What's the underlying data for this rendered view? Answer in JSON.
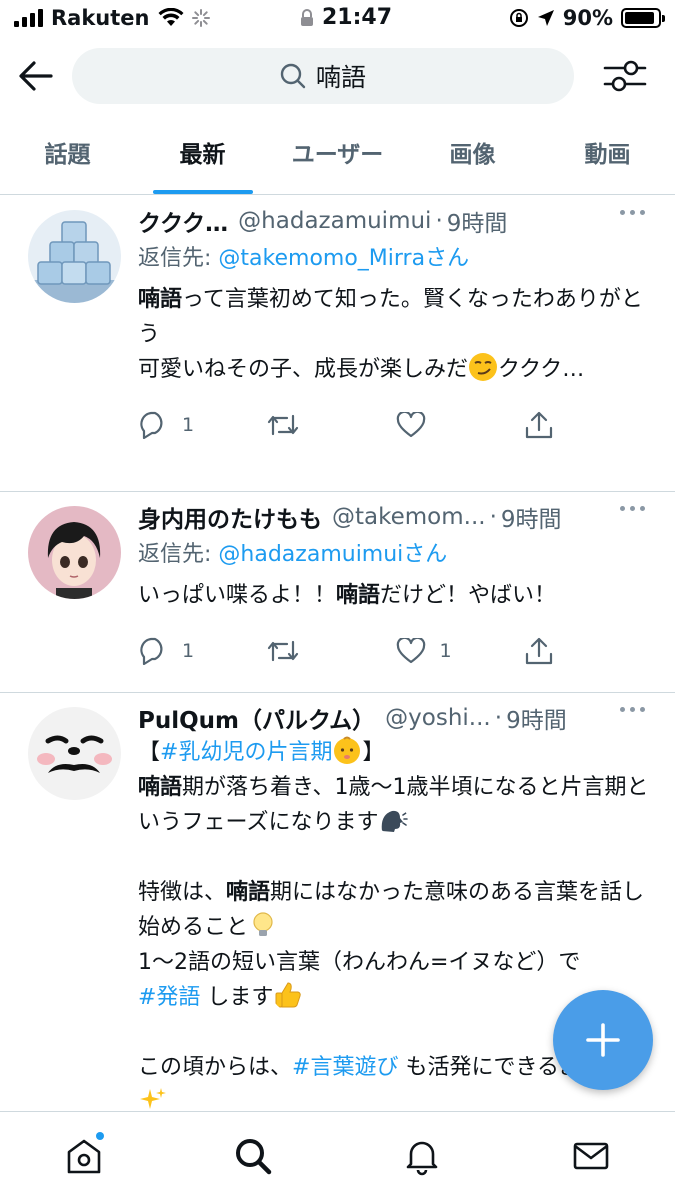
{
  "status": {
    "carrier": "Rakuten",
    "time": "21:47",
    "battery": "90%",
    "battery_level": 0.9
  },
  "search": {
    "query": "喃語"
  },
  "tabs": [
    {
      "label": "話題",
      "active": false
    },
    {
      "label": "最新",
      "active": true
    },
    {
      "label": "ユーザー",
      "active": false
    },
    {
      "label": "画像",
      "active": false
    },
    {
      "label": "動画",
      "active": false
    }
  ],
  "tweets": [
    {
      "name": "ククク…",
      "handle": "@hadazamuimui",
      "dot": "·",
      "time": "9時間",
      "reply_prefix": "返信先:",
      "reply_mention": "@takemomo_Mirraさん",
      "body": {
        "kw": "喃語",
        "t1": "って言葉初めて知った。賢くなったわありがとう",
        "t2": "可愛いねその子、成長が楽しみだ",
        "t3": "ククク…"
      },
      "replies": "1",
      "retweets": "",
      "likes": ""
    },
    {
      "name": "身内用のたけもも",
      "handle": "@takemom...",
      "dot": "·",
      "time": "9時間",
      "reply_prefix": "返信先:",
      "reply_mention": "@hadazamuimuiさん",
      "body": {
        "t1": "いっぱい喋るよ！！",
        "kw": "喃語",
        "t2": "だけど！やばい！"
      },
      "replies": "1",
      "retweets": "",
      "likes": "1"
    },
    {
      "name": "PulQum（パルクム）",
      "handle": "@yoshi...",
      "dot": "·",
      "time": "9時間",
      "body": {
        "l1_open": "【",
        "l1_tag": "#乳幼児の片言期",
        "l1_close": "】",
        "l2_kw": "喃語",
        "l2_text": "期が落ち着き、1歳〜1歳半頃になると片言期というフェーズになります",
        "l3_a": "特徴は、",
        "l3_kw": "喃語",
        "l3_b": "期にはなかった意味のある言葉を話し始めること",
        "l4": "1〜2語の短い言葉（わんわん=イヌなど）で",
        "l5_tag": "#発語",
        "l5_text": " します",
        "l6_a": "この頃からは、",
        "l6_tag": "#言葉遊び",
        "l6_b": " も活発にできるように"
      }
    }
  ],
  "icons": {
    "back": "arrow-left-icon",
    "search": "search-icon",
    "filter": "sliders-icon",
    "reply": "speech-bubble-icon",
    "retweet": "retweet-icon",
    "like": "heart-icon",
    "share": "share-icon",
    "compose": "plus-icon",
    "home": "home-icon",
    "explore": "search-icon",
    "notifications": "bell-icon",
    "messages": "mail-icon"
  },
  "colors": {
    "accent": "#1d9bf0",
    "fab": "#4a9de8",
    "muted": "#536471"
  }
}
